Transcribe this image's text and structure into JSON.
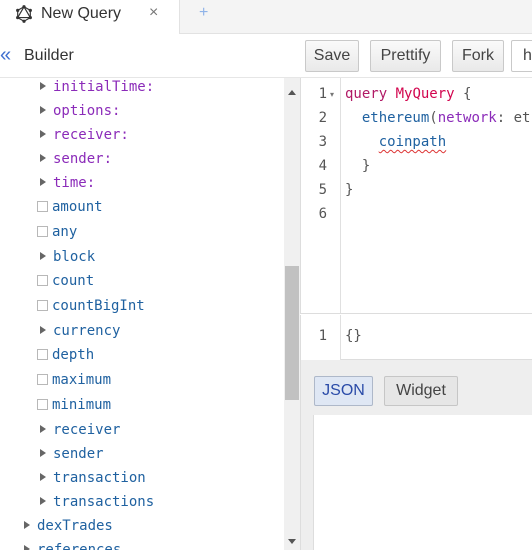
{
  "tab": {
    "title": "New Query",
    "close_glyph": "×",
    "add_glyph": "+",
    "icon": "graphql-icon"
  },
  "builder": {
    "title": "Builder",
    "collapse_glyph": "«"
  },
  "toolbar": {
    "save_label": "Save",
    "prettify_label": "Prettify",
    "fork_label": "Fork",
    "h_label": "h"
  },
  "tree": [
    {
      "label": "initialTime:",
      "kind": "arg",
      "expandable": true
    },
    {
      "label": "options:",
      "kind": "arg",
      "expandable": true
    },
    {
      "label": "receiver:",
      "kind": "arg",
      "expandable": true
    },
    {
      "label": "sender:",
      "kind": "arg",
      "expandable": true
    },
    {
      "label": "time:",
      "kind": "arg",
      "expandable": true
    },
    {
      "label": "amount",
      "kind": "field",
      "expandable": false
    },
    {
      "label": "any",
      "kind": "field",
      "expandable": false
    },
    {
      "label": "block",
      "kind": "field",
      "expandable": true
    },
    {
      "label": "count",
      "kind": "field",
      "expandable": false
    },
    {
      "label": "countBigInt",
      "kind": "field",
      "expandable": false
    },
    {
      "label": "currency",
      "kind": "field",
      "expandable": true
    },
    {
      "label": "depth",
      "kind": "field",
      "expandable": false
    },
    {
      "label": "maximum",
      "kind": "field",
      "expandable": false
    },
    {
      "label": "minimum",
      "kind": "field",
      "expandable": false
    },
    {
      "label": "receiver",
      "kind": "field",
      "expandable": true
    },
    {
      "label": "sender",
      "kind": "field",
      "expandable": true
    },
    {
      "label": "transaction",
      "kind": "field",
      "expandable": true
    },
    {
      "label": "transactions",
      "kind": "field",
      "expandable": true
    },
    {
      "label": "dexTrades",
      "kind": "field",
      "expandable": true
    },
    {
      "label": "references",
      "kind": "field",
      "expandable": true
    }
  ],
  "editor": {
    "line_numbers": [
      "1",
      "2",
      "3",
      "4",
      "5",
      "6"
    ],
    "fold_glyph": "▾",
    "code": {
      "kw_query": "query",
      "op_name": "MyQuery",
      "brace_open": "{",
      "field_ethereum": "ethereum",
      "paren_open": "(",
      "arg_network": "network",
      "colon_rest": ": et",
      "field_coinpath": "coinpath",
      "brace_close": "}"
    }
  },
  "variables": {
    "line_number": "1",
    "content": "{}"
  },
  "result": {
    "json_label": "JSON",
    "widget_label": "Widget"
  },
  "colors": {
    "arg": "#8b2bb9",
    "field": "#1f61a0",
    "keyword": "#b11a66",
    "accent": "#3f6fd0"
  }
}
